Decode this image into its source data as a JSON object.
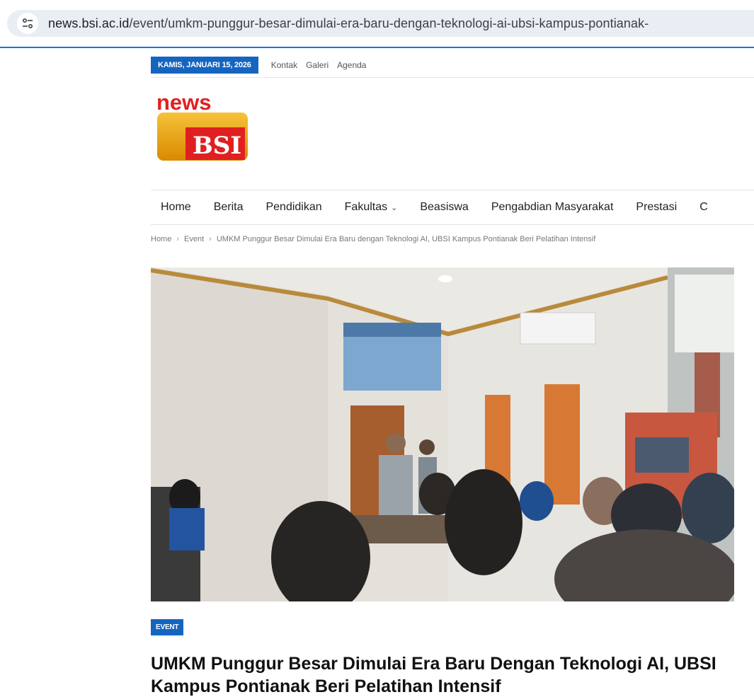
{
  "browser": {
    "url_host": "news.bsi.ac.id",
    "url_path": "/event/umkm-punggur-besar-dimulai-era-baru-dengan-teknologi-ai-ubsi-kampus-pontianak-",
    "icon": "tune-icon"
  },
  "topbar": {
    "date": "KAMIS, JANUARI 15, 2026",
    "links": [
      "Kontak",
      "Galeri",
      "Agenda"
    ]
  },
  "logo": {
    "word": "news",
    "mark": "BSI"
  },
  "nav": {
    "items": [
      "Home",
      "Berita",
      "Pendidikan",
      "Fakultas",
      "Beasiswa",
      "Pengabdian Masyarakat",
      "Prestasi",
      "C"
    ],
    "dropdown_icon": "chevron-down-icon"
  },
  "breadcrumb": {
    "items": [
      "Home",
      "Event",
      "UMKM Punggur Besar Dimulai Era Baru dengan Teknologi AI, UBSI Kampus Pontianak Beri Pelatihan Intensif"
    ],
    "separator": "›"
  },
  "article": {
    "category": "EVENT",
    "title": "UMKM Punggur Besar Dimulai Era Baru Dengan Teknologi AI, UBSI Kampus Pontianak Beri Pelatihan Intensif"
  },
  "colors": {
    "accent": "#1565c0",
    "logo_red": "#e02020",
    "logo_orange": "#f0a500"
  }
}
